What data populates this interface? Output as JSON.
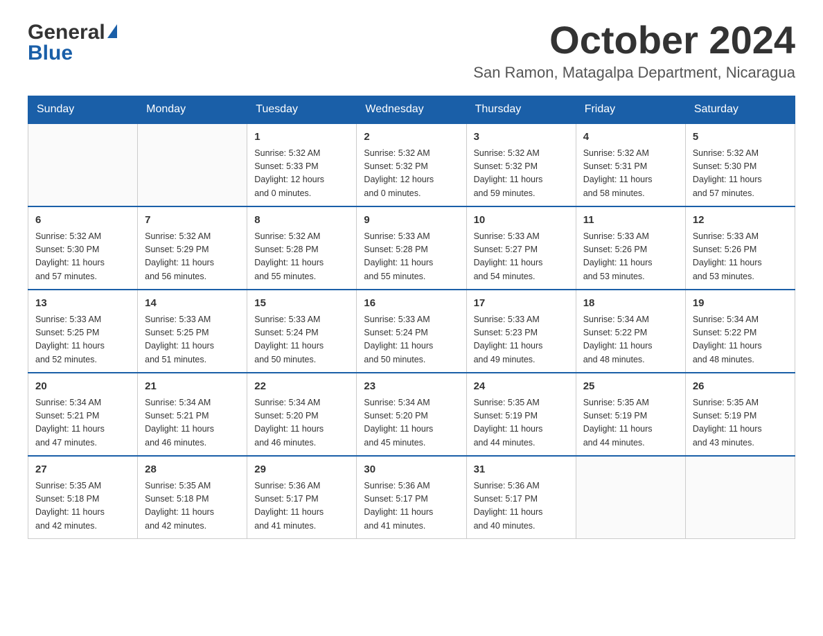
{
  "header": {
    "month_title": "October 2024",
    "location": "San Ramon, Matagalpa Department, Nicaragua"
  },
  "weekdays": [
    "Sunday",
    "Monday",
    "Tuesday",
    "Wednesday",
    "Thursday",
    "Friday",
    "Saturday"
  ],
  "weeks": [
    [
      {
        "day": "",
        "info": ""
      },
      {
        "day": "",
        "info": ""
      },
      {
        "day": "1",
        "info": "Sunrise: 5:32 AM\nSunset: 5:33 PM\nDaylight: 12 hours\nand 0 minutes."
      },
      {
        "day": "2",
        "info": "Sunrise: 5:32 AM\nSunset: 5:32 PM\nDaylight: 12 hours\nand 0 minutes."
      },
      {
        "day": "3",
        "info": "Sunrise: 5:32 AM\nSunset: 5:32 PM\nDaylight: 11 hours\nand 59 minutes."
      },
      {
        "day": "4",
        "info": "Sunrise: 5:32 AM\nSunset: 5:31 PM\nDaylight: 11 hours\nand 58 minutes."
      },
      {
        "day": "5",
        "info": "Sunrise: 5:32 AM\nSunset: 5:30 PM\nDaylight: 11 hours\nand 57 minutes."
      }
    ],
    [
      {
        "day": "6",
        "info": "Sunrise: 5:32 AM\nSunset: 5:30 PM\nDaylight: 11 hours\nand 57 minutes."
      },
      {
        "day": "7",
        "info": "Sunrise: 5:32 AM\nSunset: 5:29 PM\nDaylight: 11 hours\nand 56 minutes."
      },
      {
        "day": "8",
        "info": "Sunrise: 5:32 AM\nSunset: 5:28 PM\nDaylight: 11 hours\nand 55 minutes."
      },
      {
        "day": "9",
        "info": "Sunrise: 5:33 AM\nSunset: 5:28 PM\nDaylight: 11 hours\nand 55 minutes."
      },
      {
        "day": "10",
        "info": "Sunrise: 5:33 AM\nSunset: 5:27 PM\nDaylight: 11 hours\nand 54 minutes."
      },
      {
        "day": "11",
        "info": "Sunrise: 5:33 AM\nSunset: 5:26 PM\nDaylight: 11 hours\nand 53 minutes."
      },
      {
        "day": "12",
        "info": "Sunrise: 5:33 AM\nSunset: 5:26 PM\nDaylight: 11 hours\nand 53 minutes."
      }
    ],
    [
      {
        "day": "13",
        "info": "Sunrise: 5:33 AM\nSunset: 5:25 PM\nDaylight: 11 hours\nand 52 minutes."
      },
      {
        "day": "14",
        "info": "Sunrise: 5:33 AM\nSunset: 5:25 PM\nDaylight: 11 hours\nand 51 minutes."
      },
      {
        "day": "15",
        "info": "Sunrise: 5:33 AM\nSunset: 5:24 PM\nDaylight: 11 hours\nand 50 minutes."
      },
      {
        "day": "16",
        "info": "Sunrise: 5:33 AM\nSunset: 5:24 PM\nDaylight: 11 hours\nand 50 minutes."
      },
      {
        "day": "17",
        "info": "Sunrise: 5:33 AM\nSunset: 5:23 PM\nDaylight: 11 hours\nand 49 minutes."
      },
      {
        "day": "18",
        "info": "Sunrise: 5:34 AM\nSunset: 5:22 PM\nDaylight: 11 hours\nand 48 minutes."
      },
      {
        "day": "19",
        "info": "Sunrise: 5:34 AM\nSunset: 5:22 PM\nDaylight: 11 hours\nand 48 minutes."
      }
    ],
    [
      {
        "day": "20",
        "info": "Sunrise: 5:34 AM\nSunset: 5:21 PM\nDaylight: 11 hours\nand 47 minutes."
      },
      {
        "day": "21",
        "info": "Sunrise: 5:34 AM\nSunset: 5:21 PM\nDaylight: 11 hours\nand 46 minutes."
      },
      {
        "day": "22",
        "info": "Sunrise: 5:34 AM\nSunset: 5:20 PM\nDaylight: 11 hours\nand 46 minutes."
      },
      {
        "day": "23",
        "info": "Sunrise: 5:34 AM\nSunset: 5:20 PM\nDaylight: 11 hours\nand 45 minutes."
      },
      {
        "day": "24",
        "info": "Sunrise: 5:35 AM\nSunset: 5:19 PM\nDaylight: 11 hours\nand 44 minutes."
      },
      {
        "day": "25",
        "info": "Sunrise: 5:35 AM\nSunset: 5:19 PM\nDaylight: 11 hours\nand 44 minutes."
      },
      {
        "day": "26",
        "info": "Sunrise: 5:35 AM\nSunset: 5:19 PM\nDaylight: 11 hours\nand 43 minutes."
      }
    ],
    [
      {
        "day": "27",
        "info": "Sunrise: 5:35 AM\nSunset: 5:18 PM\nDaylight: 11 hours\nand 42 minutes."
      },
      {
        "day": "28",
        "info": "Sunrise: 5:35 AM\nSunset: 5:18 PM\nDaylight: 11 hours\nand 42 minutes."
      },
      {
        "day": "29",
        "info": "Sunrise: 5:36 AM\nSunset: 5:17 PM\nDaylight: 11 hours\nand 41 minutes."
      },
      {
        "day": "30",
        "info": "Sunrise: 5:36 AM\nSunset: 5:17 PM\nDaylight: 11 hours\nand 41 minutes."
      },
      {
        "day": "31",
        "info": "Sunrise: 5:36 AM\nSunset: 5:17 PM\nDaylight: 11 hours\nand 40 minutes."
      },
      {
        "day": "",
        "info": ""
      },
      {
        "day": "",
        "info": ""
      }
    ]
  ]
}
